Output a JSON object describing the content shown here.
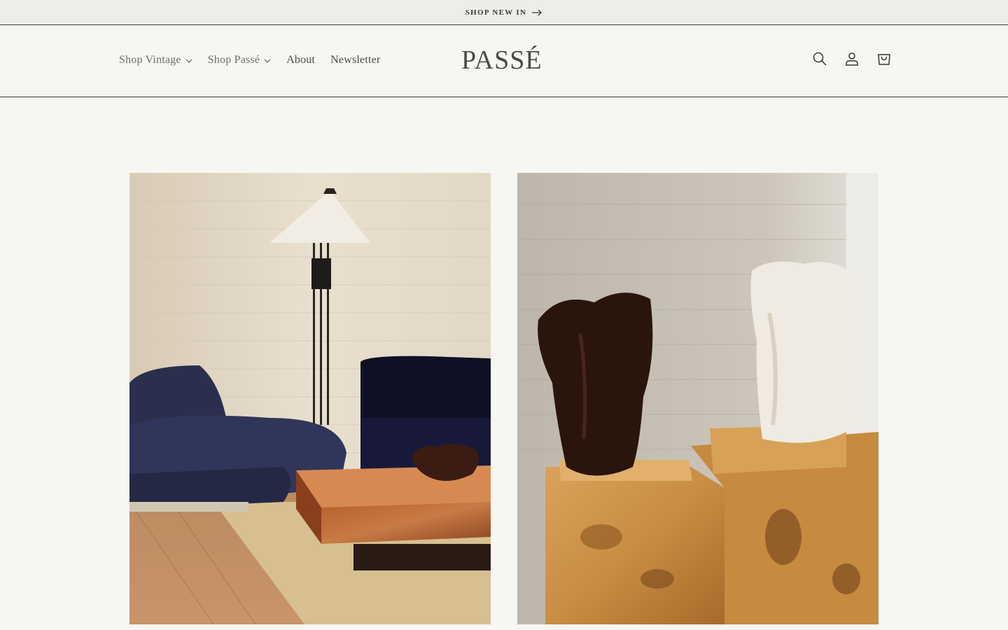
{
  "announcement": {
    "text": "SHOP NEW IN",
    "icon": "arrow-right-icon"
  },
  "header": {
    "logo": "PASSÉ",
    "nav": [
      {
        "label": "Shop Vintage",
        "has_dropdown": true
      },
      {
        "label": "Shop Passé",
        "has_dropdown": true
      },
      {
        "label": "About",
        "has_dropdown": false
      },
      {
        "label": "Newsletter",
        "has_dropdown": false
      }
    ],
    "icons": [
      "search-icon",
      "account-icon",
      "cart-icon"
    ]
  },
  "gallery": {
    "images": [
      {
        "subject": "living room with navy sofas, pleated floor lamp and burl coffee table"
      },
      {
        "subject": "brown and white ceramic vases on burl wood pedestals"
      }
    ]
  },
  "colors": {
    "background": "#f7f6f2",
    "announcement_bg": "#eceee9",
    "text": "#4a4a4a"
  }
}
